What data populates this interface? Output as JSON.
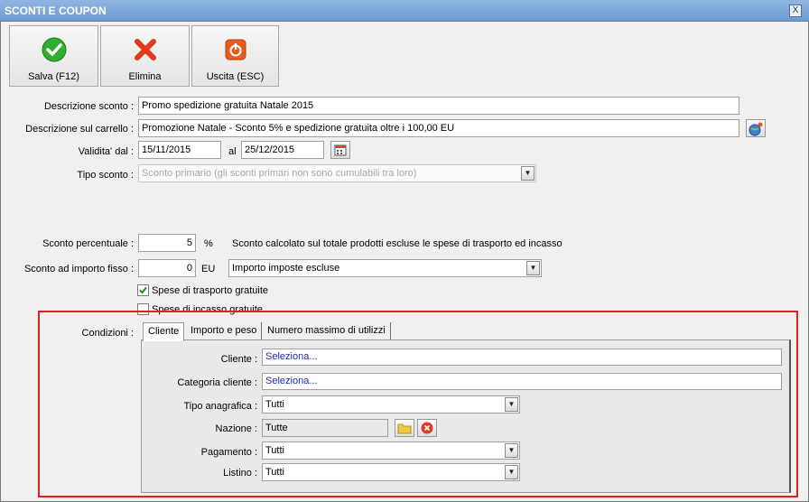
{
  "window": {
    "title": "SCONTI E COUPON",
    "close_glyph": "X"
  },
  "toolbar": {
    "save_label": "Salva (F12)",
    "delete_label": "Elimina",
    "exit_label": "Uscita (ESC)"
  },
  "form": {
    "descrizione_sconto_label": "Descrizione sconto :",
    "descrizione_sconto_value": "Promo spedizione gratuita Natale 2015",
    "descrizione_carrello_label": "Descrizione sul carrello :",
    "descrizione_carrello_value": "Promozione Natale - Sconto 5% e spedizione gratuita oltre i 100,00 EU",
    "validita_label": "Validita' dal :",
    "validita_dal": "15/11/2015",
    "al_label": "al",
    "validita_al": "25/12/2015",
    "tipo_sconto_label": "Tipo sconto :",
    "tipo_sconto_value": "Sconto primario (gli sconti primari non sono cumulabili tra loro)",
    "sconto_percentuale_label": "Sconto percentuale :",
    "sconto_percentuale_value": "5",
    "percent_unit": "%",
    "sconto_note": "Sconto calcolato sul totale prodotti escluse le spese di trasporto ed incasso",
    "sconto_importo_label": "Sconto ad importo fisso :",
    "sconto_importo_value": "0",
    "eu_unit": "EU",
    "imposte_value": "Importo imposte escluse",
    "spese_trasporto_label": "Spese di trasporto gratuite",
    "spese_trasporto_checked": true,
    "spese_incasso_label": "Spese di incasso gratuite",
    "spese_incasso_checked": false
  },
  "condizioni": {
    "label": "Condizioni :",
    "tabs": [
      {
        "label": "Cliente",
        "active": true
      },
      {
        "label": "Importo e peso",
        "active": false
      },
      {
        "label": "Numero massimo di utilizzi",
        "active": false
      }
    ],
    "cliente_label": "Cliente :",
    "cliente_value": "Seleziona...",
    "categoria_label": "Categoria cliente :",
    "categoria_value": "Seleziona...",
    "tipo_anagrafica_label": "Tipo anagrafica :",
    "tipo_anagrafica_value": "Tutti",
    "nazione_label": "Nazione :",
    "nazione_value": "Tutte",
    "pagamento_label": "Pagamento :",
    "pagamento_value": "Tutti",
    "listino_label": "Listino :",
    "listino_value": "Tutti"
  },
  "colors": {
    "title_bar": "#7ba3d8",
    "highlight_border": "#e02020",
    "link_text": "#1a2fa8"
  },
  "icons": [
    "check-icon",
    "delete-x-icon",
    "exit-power-icon",
    "globe-icon",
    "calendar-icon",
    "folder-icon",
    "clear-icon",
    "checkbox-check-icon"
  ]
}
